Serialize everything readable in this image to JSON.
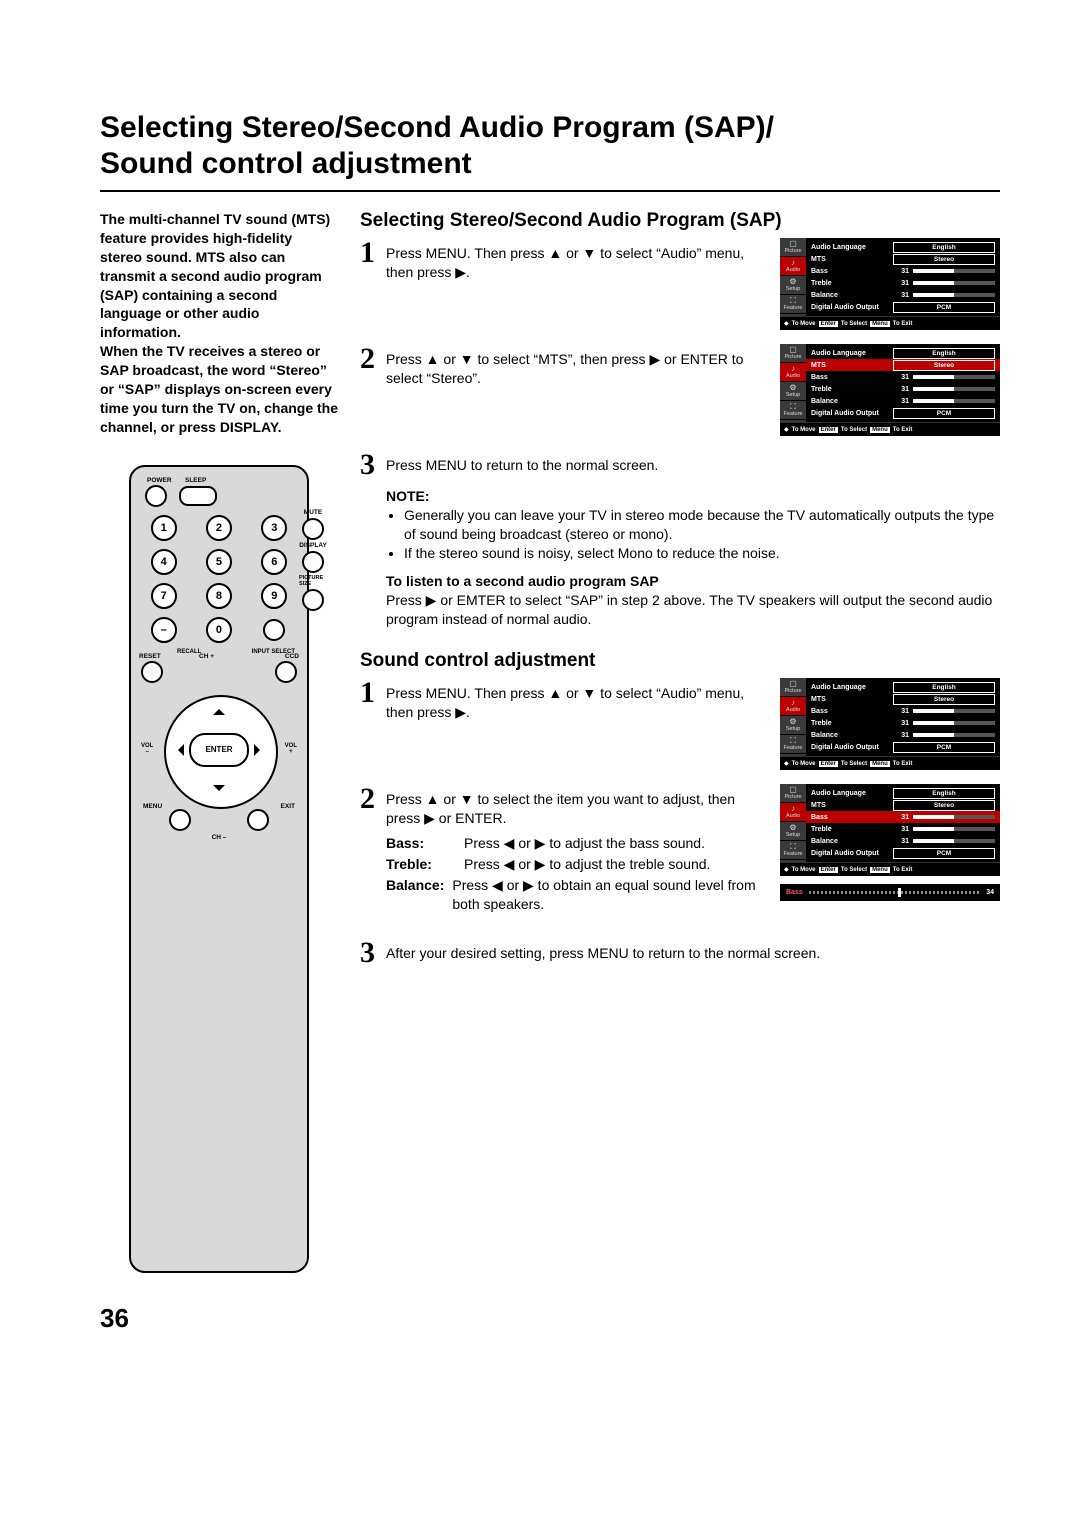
{
  "title_line1": "Selecting Stereo/Second Audio Program (SAP)/",
  "title_line2": "Sound control adjustment",
  "intro": "The multi-channel TV sound (MTS) feature provides high-fidelity stereo sound. MTS also can transmit a second audio program (SAP) containing a second language or other audio information.\nWhen the TV receives a stereo or SAP broadcast, the word “Stereo” or “SAP” displays on-screen every time you turn the TV on, change the channel, or press DISPLAY.",
  "sectionA": {
    "heading": "Selecting Stereo/Second Audio Program (SAP)",
    "step1": "Press MENU. Then press ▲ or ▼ to select “Audio” menu, then press ▶.",
    "step2": "Press ▲ or ▼ to select “MTS”, then press ▶ or ENTER to select “Stereo”.",
    "step3": "Press MENU to return to the normal screen.",
    "note_hd": "NOTE:",
    "note1": "Generally you can leave your TV in stereo mode because the TV automatically outputs the type of sound being broadcast (stereo or mono).",
    "note2": "If the stereo sound is noisy, select Mono to reduce the noise.",
    "sap_hd": "To listen to a second audio program SAP",
    "sap_body": "Press ▶ or EMTER to select “SAP” in step 2 above. The TV speakers will output the second audio program instead of normal audio."
  },
  "sectionB": {
    "heading": "Sound control adjustment",
    "step1": "Press MENU. Then press ▲ or ▼ to select “Audio” menu, then press ▶.",
    "step2_a": "Press ▲ or ▼ to select the item you want to adjust, then press ▶ or ENTER.",
    "adj_bass_l": "Bass:",
    "adj_bass_v": "Press ◀ or ▶ to adjust the bass sound.",
    "adj_treble_l": "Treble:",
    "adj_treble_v": "Press ◀ or ▶ to adjust the treble sound.",
    "adj_balance_l": "Balance:",
    "adj_balance_v": "Press ◀ or ▶ to obtain an equal sound level from both speakers.",
    "step3": "After your desired setting, press MENU to return to the normal screen."
  },
  "osd": {
    "tabs": [
      "Picture",
      "Audio",
      "Setup",
      "Feature"
    ],
    "rows": {
      "lang_l": "Audio Language",
      "lang_v": "English",
      "mts_l": "MTS",
      "mts_v": "Stereo",
      "bass_l": "Bass",
      "bass_v": "31",
      "treble_l": "Treble",
      "treble_v": "31",
      "balance_l": "Balance",
      "balance_v": "31",
      "dao_l": "Digital Audio Output",
      "dao_v": "PCM"
    },
    "foot_move": "To Move",
    "foot_enter": "Enter",
    "foot_select": "To Select",
    "foot_menu": "Menu",
    "foot_exit": "To Exit",
    "slider_name": "Bass",
    "slider_val": "34"
  },
  "remote": {
    "power": "POWER",
    "sleep": "SLEEP",
    "mute": "MUTE",
    "display": "DISPLAY",
    "picsize": "PICTURE SIZE",
    "recall": "RECALL",
    "inputsel": "INPUT SELECT",
    "reset": "RESET",
    "chp": "CH +",
    "ccd": "CCD",
    "volm": "VOL",
    "volp": "VOL",
    "enter": "ENTER",
    "menu": "MENU",
    "exit": "EXIT",
    "chm": "CH –",
    "n0": "0",
    "n1": "1",
    "n2": "2",
    "n3": "3",
    "n4": "4",
    "n5": "5",
    "n6": "6",
    "n7": "7",
    "n8": "8",
    "n9": "9",
    "dash": "–"
  },
  "pagenum": "36"
}
